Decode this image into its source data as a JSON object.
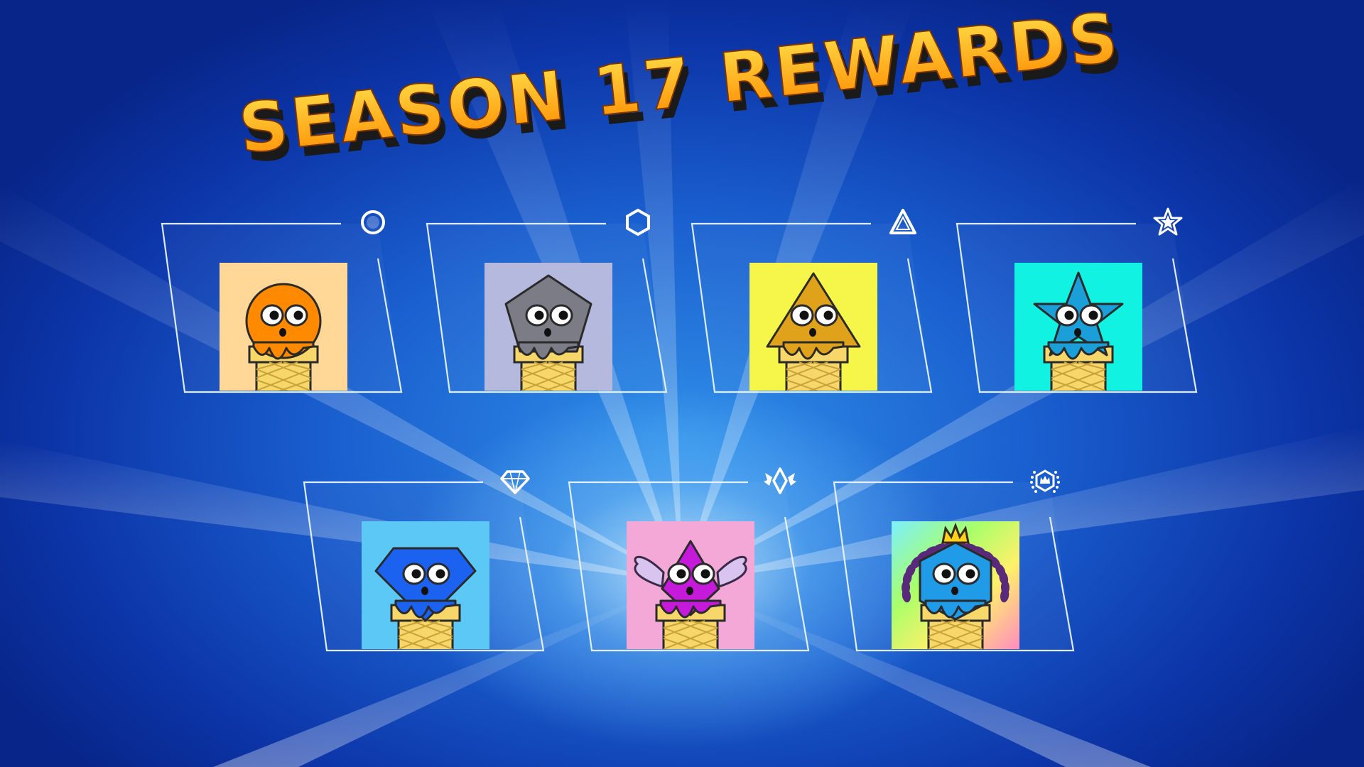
{
  "title": "SEASON 17 REWARDS",
  "title_colors": {
    "top": "#ffe14a",
    "bottom": "#ff8a00",
    "shadow": "#1a1a1a"
  },
  "rows": [
    [
      {
        "tier_icon": "circle-tier-icon",
        "bg": "#ffd796",
        "body": "#ff8a00",
        "shape": "circle"
      },
      {
        "tier_icon": "hexagon-tier-icon",
        "bg": "#b4b9dd",
        "body": "#7c7c86",
        "shape": "pentagon"
      },
      {
        "tier_icon": "triangle-tier-icon",
        "bg": "#f6f64a",
        "body": "#e0a21a",
        "shape": "triangle"
      },
      {
        "tier_icon": "star-tier-icon",
        "bg": "#12f2e2",
        "body": "#1a9fd9",
        "shape": "star"
      }
    ],
    [
      {
        "tier_icon": "diamond-tier-icon",
        "bg": "#5cc8f5",
        "body": "#1b62f0",
        "shape": "gem"
      },
      {
        "tier_icon": "winged-diamond-tier-icon",
        "bg": "#f4a8d8",
        "body": "#c51ad9",
        "shape": "winged"
      },
      {
        "tier_icon": "crown-laurel-tier-icon",
        "bg": "rainbow",
        "body": "#1f9be8",
        "shape": "crowned"
      }
    ]
  ]
}
